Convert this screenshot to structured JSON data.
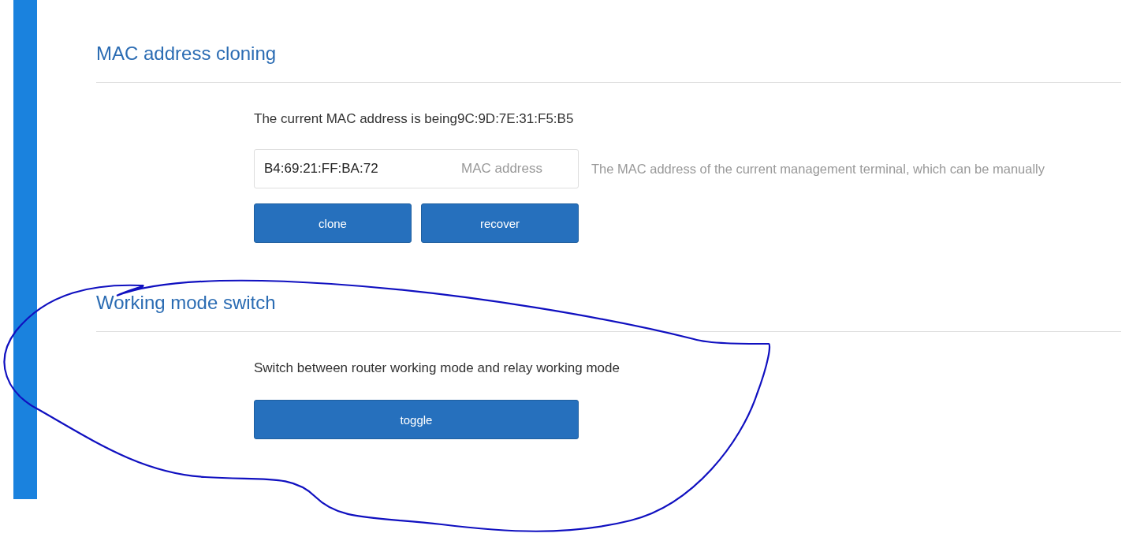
{
  "sections": [
    {
      "title": "MAC address cloning",
      "description": "The current MAC address is being9C:9D:7E:31:F5:B5",
      "field": {
        "value": "B4:69:21:FF:BA:72",
        "label": "MAC address",
        "help": "The MAC address of the current management terminal, which can be manually"
      },
      "buttons": [
        "clone",
        "recover"
      ]
    },
    {
      "title": "Working mode switch",
      "description": "Switch between router working mode and relay working mode",
      "buttons": [
        "toggle"
      ]
    }
  ]
}
